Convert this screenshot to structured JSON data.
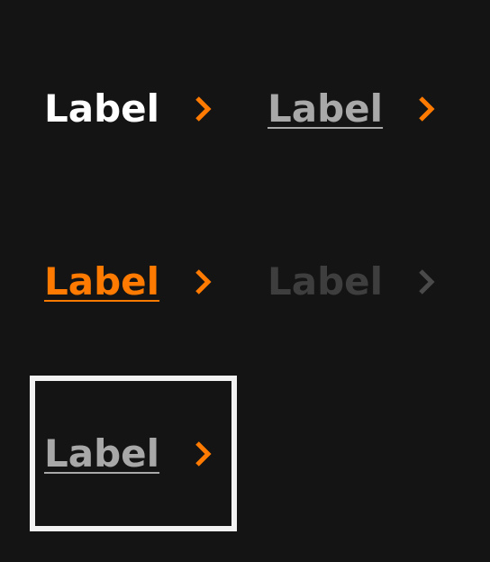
{
  "colors": {
    "background": "#141414",
    "accent": "#ff7a00",
    "default_text": "#ffffff",
    "hover_text": "#a8a8a8",
    "disabled_text": "#3e3e3e",
    "disabled_icon": "#4a4a4a",
    "focus_ring": "#f2f2f2"
  },
  "links": [
    {
      "state": "default",
      "label": "Label",
      "icon": "chevron-right-icon"
    },
    {
      "state": "hover",
      "label": "Label",
      "icon": "chevron-right-icon"
    },
    {
      "state": "active",
      "label": "Label",
      "icon": "chevron-right-icon"
    },
    {
      "state": "disabled",
      "label": "Label",
      "icon": "chevron-right-icon"
    },
    {
      "state": "focus",
      "label": "Label",
      "icon": "chevron-right-icon"
    }
  ]
}
